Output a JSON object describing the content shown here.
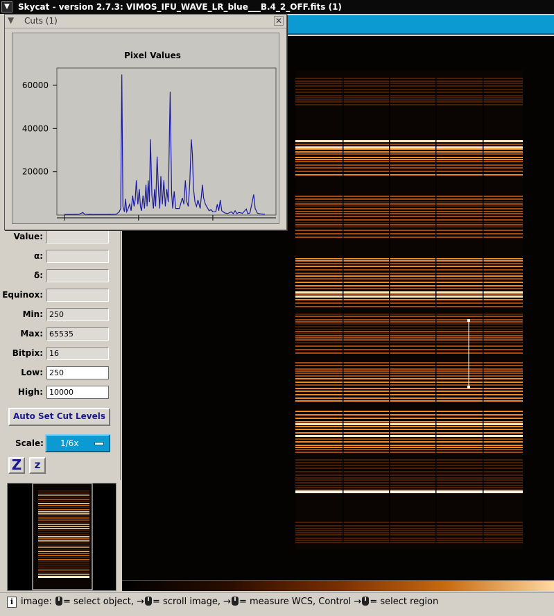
{
  "window": {
    "title": "Skycat - version 2.7.3: VIMOS_IFU_WAVE_LR_blue___B.4_2_OFF.fits (1)",
    "menu_icon": "chevron-down-icon"
  },
  "cuts_dialog": {
    "title": "Cuts (1)",
    "close_icon": "close-icon",
    "minimize_icon": "chevron-down-icon"
  },
  "info_panel": {
    "fields": [
      {
        "label": "Value:",
        "value": "",
        "editable": false
      },
      {
        "label": "α:",
        "value": "",
        "editable": false
      },
      {
        "label": "δ:",
        "value": "",
        "editable": false
      },
      {
        "label": "Equinox:",
        "value": "",
        "editable": false
      },
      {
        "label": "Min:",
        "value": "250",
        "editable": false
      },
      {
        "label": "Max:",
        "value": "65535",
        "editable": false
      },
      {
        "label": "Bitpix:",
        "value": "16",
        "editable": false
      },
      {
        "label": "Low:",
        "value": "250",
        "editable": true
      },
      {
        "label": "High:",
        "value": "10000",
        "editable": true
      }
    ],
    "auto_cut_label": "Auto Set Cut Levels",
    "scale_label": "Scale:",
    "scale_value": "1/6x",
    "zoom_in_label": "Z",
    "zoom_out_label": "z"
  },
  "status_bar": {
    "icon": "info-icon",
    "info_glyph": "i",
    "parts": [
      "image: ",
      "= select object, →",
      "= scroll image, →",
      "= measure WCS, Control →",
      "= select region"
    ]
  },
  "colors": {
    "menu_accent": "#0b9ad1",
    "plot_line": "#1a1aa0",
    "image_bright": "#ffd9a0",
    "image_mid": "#c96a10"
  },
  "chart_data": {
    "type": "line",
    "title": "Pixel Values",
    "xlabel": "",
    "ylabel": "",
    "xlim": [
      -20,
      570
    ],
    "ylim": [
      0,
      68000
    ],
    "xticks": [
      0,
      200,
      400
    ],
    "yticks": [
      20000,
      40000,
      60000
    ],
    "grid": false,
    "series": [
      {
        "values_xy": [
          [
            0,
            300
          ],
          [
            20,
            300
          ],
          [
            40,
            400
          ],
          [
            50,
            1200
          ],
          [
            55,
            400
          ],
          [
            80,
            300
          ],
          [
            100,
            300
          ],
          [
            120,
            300
          ],
          [
            140,
            400
          ],
          [
            148,
            1500
          ],
          [
            152,
            3000
          ],
          [
            155,
            65000
          ],
          [
            158,
            4000
          ],
          [
            162,
            1500
          ],
          [
            165,
            7500
          ],
          [
            168,
            1500
          ],
          [
            172,
            3000
          ],
          [
            176,
            5000
          ],
          [
            180,
            2000
          ],
          [
            184,
            9000
          ],
          [
            188,
            4000
          ],
          [
            191,
            7000
          ],
          [
            194,
            16000
          ],
          [
            198,
            5000
          ],
          [
            202,
            12000
          ],
          [
            205,
            4000
          ],
          [
            208,
            2000
          ],
          [
            212,
            9000
          ],
          [
            216,
            3000
          ],
          [
            220,
            14000
          ],
          [
            223,
            4000
          ],
          [
            226,
            16000
          ],
          [
            229,
            6000
          ],
          [
            232,
            35000
          ],
          [
            236,
            9000
          ],
          [
            240,
            3000
          ],
          [
            243,
            12000
          ],
          [
            246,
            4000
          ],
          [
            250,
            27000
          ],
          [
            254,
            10000
          ],
          [
            257,
            3000
          ],
          [
            260,
            18000
          ],
          [
            264,
            5000
          ],
          [
            268,
            16000
          ],
          [
            272,
            4000
          ],
          [
            276,
            12000
          ],
          [
            280,
            6000
          ],
          [
            285,
            57000
          ],
          [
            289,
            10000
          ],
          [
            292,
            3000
          ],
          [
            296,
            11000
          ],
          [
            300,
            3000
          ],
          [
            310,
            3000
          ],
          [
            318,
            8000
          ],
          [
            322,
            5000
          ],
          [
            326,
            16000
          ],
          [
            330,
            6000
          ],
          [
            334,
            4000
          ],
          [
            338,
            15000
          ],
          [
            342,
            35000
          ],
          [
            345,
            28000
          ],
          [
            348,
            12000
          ],
          [
            352,
            6000
          ],
          [
            356,
            4000
          ],
          [
            360,
            7000
          ],
          [
            366,
            3000
          ],
          [
            372,
            14000
          ],
          [
            375,
            8000
          ],
          [
            380,
            5000
          ],
          [
            390,
            2000
          ],
          [
            395,
            2500
          ],
          [
            400,
            1500
          ],
          [
            408,
            1500
          ],
          [
            412,
            5000
          ],
          [
            416,
            2000
          ],
          [
            420,
            7000
          ],
          [
            424,
            2000
          ],
          [
            432,
            1000
          ],
          [
            440,
            700
          ],
          [
            450,
            1500
          ],
          [
            455,
            600
          ],
          [
            460,
            2000
          ],
          [
            465,
            600
          ],
          [
            470,
            1200
          ],
          [
            480,
            800
          ],
          [
            490,
            2800
          ],
          [
            494,
            600
          ],
          [
            500,
            1000
          ],
          [
            510,
            9500
          ],
          [
            514,
            3000
          ],
          [
            520,
            900
          ],
          [
            530,
            500
          ],
          [
            540,
            400
          ]
        ]
      }
    ]
  }
}
